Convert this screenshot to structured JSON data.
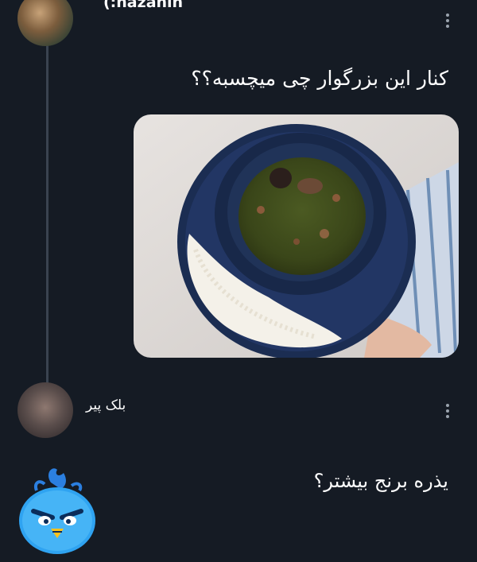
{
  "thread": {
    "first": {
      "username": "(:nazanin",
      "text": "کنار این بزرگوار چی میچسبه؟؟"
    },
    "second": {
      "name": "بلک پیر"
    },
    "third": {
      "text": "یذره برنج بیشتر؟"
    }
  },
  "icons": {
    "more_menu": "more-vertical-icon",
    "mascot": "angry-blue-bird-icon"
  },
  "colors": {
    "background": "#151b24",
    "thread_line": "#3a4350",
    "text": "#ffffff",
    "muted": "#9aa3ad"
  }
}
